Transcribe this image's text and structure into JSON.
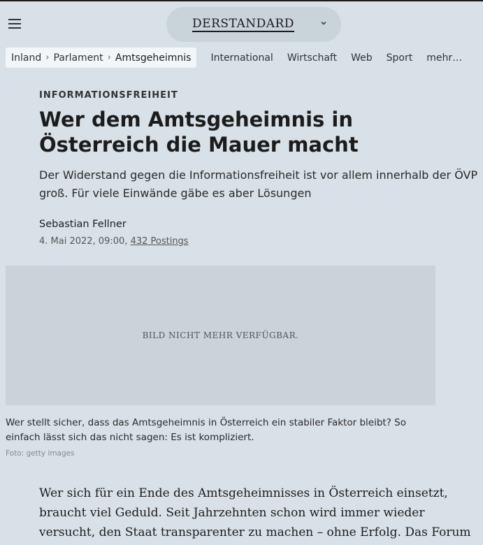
{
  "header": {
    "logo": "DERSTANDARD",
    "menu_icon": "hamburger-menu-icon",
    "chevron_icon": "chevron-down-icon"
  },
  "breadcrumb": {
    "items": [
      "Inland",
      "Parlament",
      "Amtsgeheimnis"
    ]
  },
  "nav": {
    "links": [
      "International",
      "Wirtschaft",
      "Web",
      "Sport",
      "mehr…"
    ]
  },
  "article": {
    "kicker": "INFORMATIONSFREIHEIT",
    "title": "Wer dem Amtsgeheimnis in Österreich die Mauer macht",
    "lead": "Der Widerstand gegen die Informationsfreiheit ist vor allem innerhalb der ÖVP groß. Für viele Einwände gäbe es aber Lösungen",
    "author": "Sebastian Fellner",
    "date": "4. Mai 2022, 09:00,",
    "postings": "432 Postings",
    "image_placeholder": "BILD NICHT MEHR VERFÜGBAR.",
    "caption": "Wer stellt sicher, dass das Amtsgeheimnis in Österreich ein stabiler Faktor bleibt? So einfach lässt sich das nicht sagen: Es ist kompliziert.",
    "credit": "Foto: getty images",
    "body": "Wer sich für ein Ende des Amtsgeheimnisses in Österreich einsetzt, braucht viel Geduld. Seit Jahrzehnten schon wird immer wieder versucht, den Staat transparenter zu machen – ohne Erfolg. Das Forum"
  }
}
